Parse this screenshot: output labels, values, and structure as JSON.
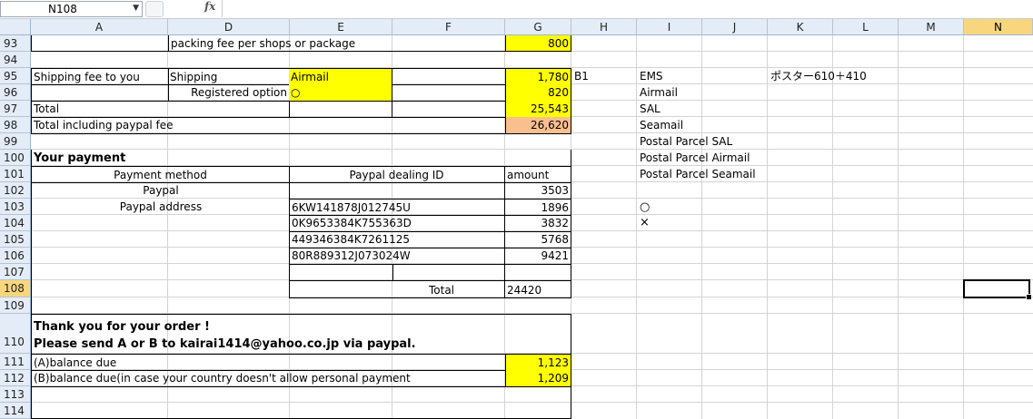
{
  "formula_bar": {
    "name_box": "N108",
    "fx_label": "fx",
    "formula": ""
  },
  "columns": [
    "A",
    "D",
    "E",
    "F",
    "G",
    "H",
    "I",
    "J",
    "K",
    "L",
    "M",
    "N"
  ],
  "rows": [
    "93",
    "94",
    "95",
    "96",
    "97",
    "98",
    "99",
    "100",
    "101",
    "102",
    "103",
    "104",
    "105",
    "106",
    "107",
    "108",
    "109",
    "110",
    "111",
    "112",
    "113",
    "114"
  ],
  "cells": {
    "d93": "packing fee per shops or package",
    "g93": "800",
    "a95": "Shipping fee to you",
    "d95": "Shipping",
    "e95": "Airmail",
    "g95": "1,780",
    "h95": "B1",
    "i95": "EMS",
    "k95": "ポスター610＋410",
    "d96": "Registered option",
    "e96": "○",
    "g96": "820",
    "i96": "Airmail",
    "a97": "Total",
    "g97": "25,543",
    "i97": "SAL",
    "a98": "Total including paypal fee",
    "g98": "26,620",
    "i98": "Seamail",
    "i99": "Postal Parcel SAL",
    "a100": "Your payment",
    "i100": "Postal Parcel Airmail",
    "a101": "Payment method",
    "e101": "Paypal dealing ID",
    "g101": "amount",
    "i101": "Postal Parcel Seamail",
    "a102": "Paypal",
    "g102": "3503",
    "a103": "Paypal address",
    "e103": "6KW141878J012745U",
    "g103": "1896",
    "i103": "○",
    "e104": "0K9653384K755363D",
    "g104": "3832",
    "i104": "×",
    "e105": "449346384K7261125",
    "g105": "5768",
    "e106": "80R889312J073024W",
    "g106": "9421",
    "f108": "Total",
    "g108": "24420",
    "a110_1": "Thank you for your order !",
    "a110_2": "Please send A or B to kairai1414@yahoo.co.jp via paypal.",
    "a111": "(A)balance due",
    "g111": "1,123",
    "a112": "(B)balance due(in case your country doesn't allow personal payment",
    "g112": "1,209"
  },
  "colors": {
    "highlight": "#ffff00",
    "total_fee": "#fabf8f",
    "header_bg": "#e4ecf7",
    "selected_header": "#f8d67d"
  }
}
